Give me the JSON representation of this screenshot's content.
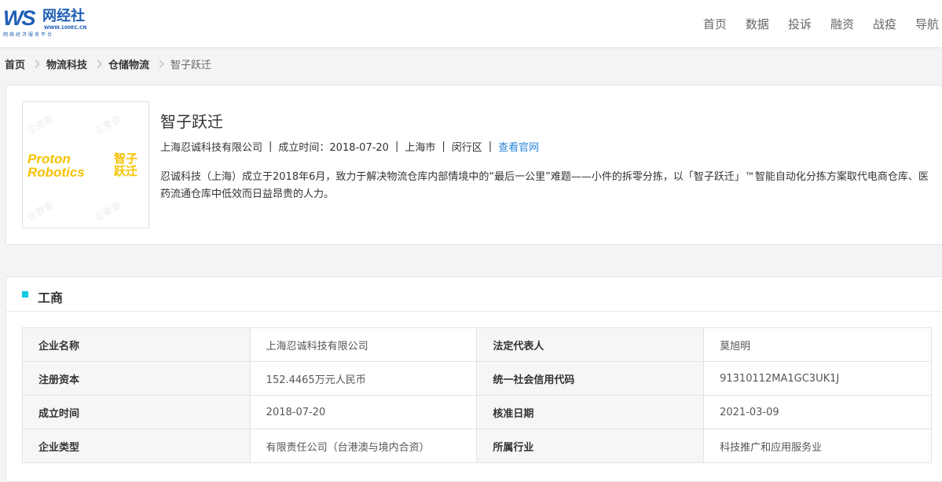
{
  "header": {
    "logo": {
      "mark": "WS",
      "cn": "网经社",
      "url": "WWW.100EC.CN",
      "slogan": "网络经济服务平台"
    },
    "nav": [
      "首页",
      "数据",
      "投诉",
      "融资",
      "战疫",
      "导航"
    ]
  },
  "breadcrumb": [
    "首页",
    "物流科技",
    "仓储物流",
    "智子跃迁"
  ],
  "company": {
    "name": "智子跃迁",
    "logo_text_en": [
      "Proton",
      "Robotics"
    ],
    "logo_text_cn": "智子跃迁",
    "watermark": "企查查",
    "entity": "上海忍诚科技有限公司",
    "founded": "成立时间：2018-07-20",
    "city": "上海市",
    "district": "闵行区",
    "website_link": "查看官网",
    "description": "忍诚科技（上海）成立于2018年6月，致力于解决物流仓库内部情境中的“最后一公里”难题——小件的拆零分拣，以「智子跃迁」™智能自动化分拣方案取代电商仓库、医药流通仓库中低效而日益昂贵的人力。"
  },
  "business": {
    "title": "工商",
    "rows": [
      [
        "企业名称",
        "上海忍诚科技有限公司",
        "法定代表人",
        "莫旭明"
      ],
      [
        "注册资本",
        "152.4465万元人民币",
        "统一社会信用代码",
        "91310112MA1GC3UK1J"
      ],
      [
        "成立时间",
        "2018-07-20",
        "核准日期",
        "2021-03-09"
      ],
      [
        "企业类型",
        "有限责任公司（台港澳与境内合资）",
        "所属行业",
        "科技推广和应用服务业"
      ]
    ]
  },
  "colors": {
    "accent": "#12c9e3",
    "link": "#2a85d8",
    "brand": "#1f5fb5",
    "logo_yellow": "#f6c200"
  }
}
